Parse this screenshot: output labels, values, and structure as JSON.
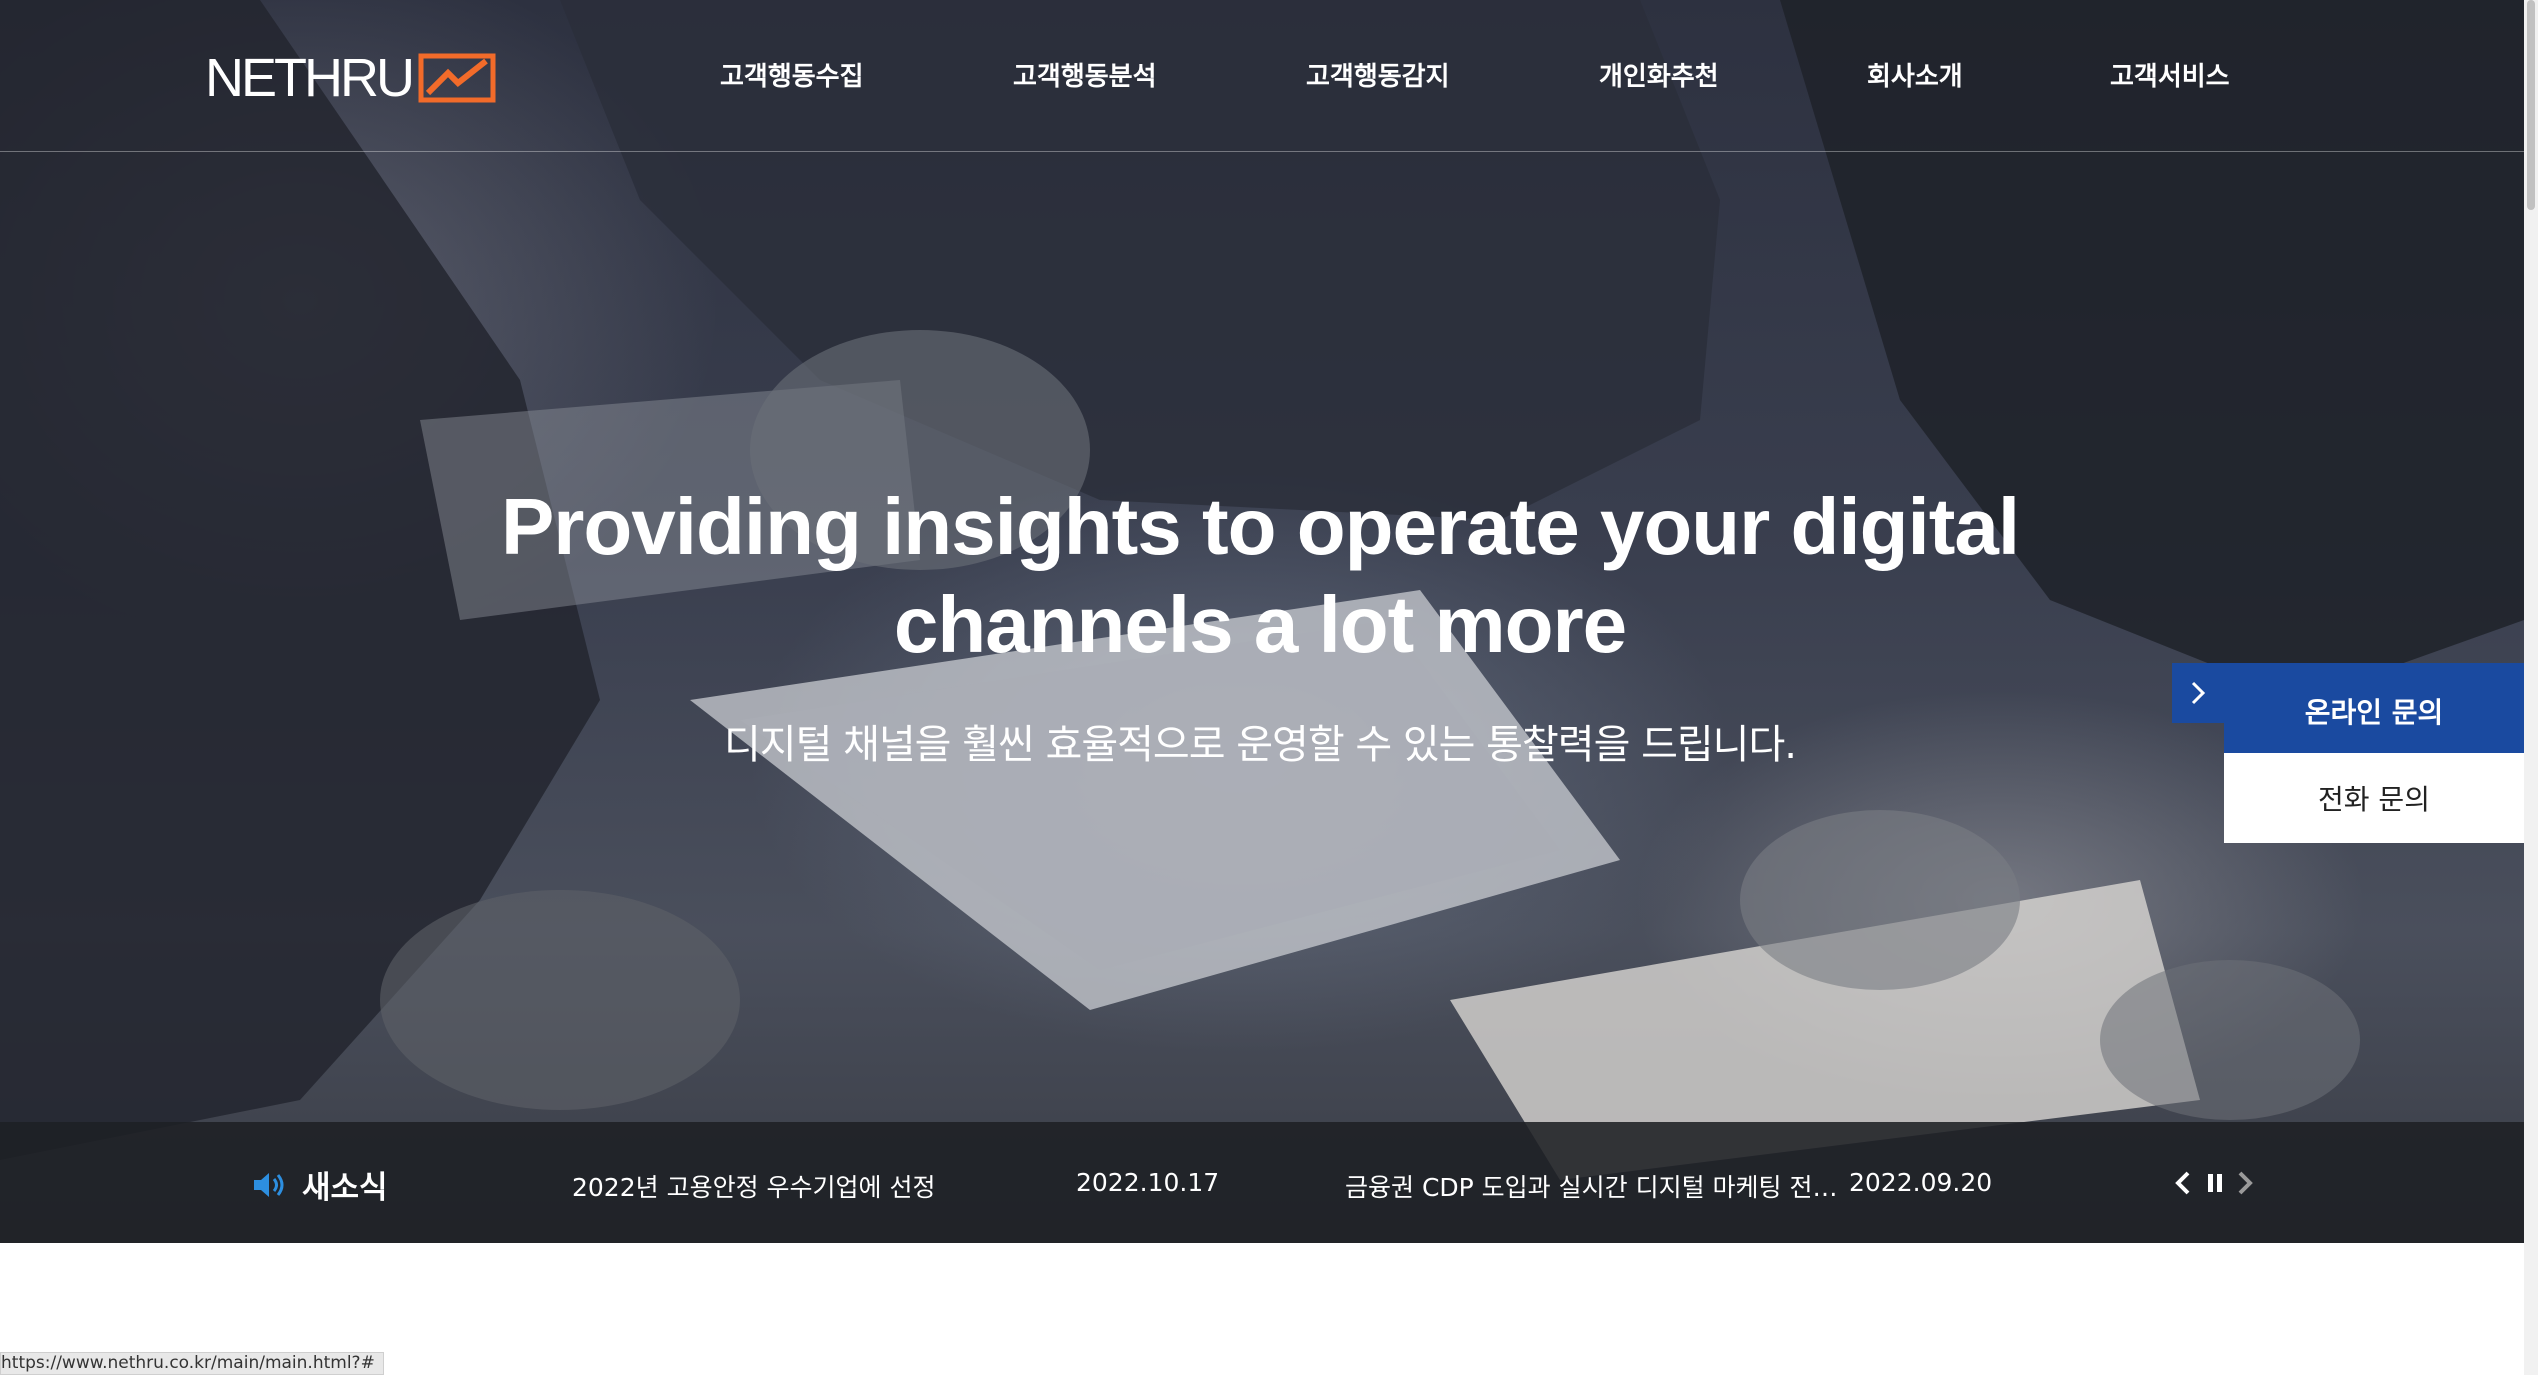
{
  "header": {
    "logo_text": "NETHRU",
    "nav": [
      {
        "label": "고객행동수집"
      },
      {
        "label": "고객행동분석"
      },
      {
        "label": "고객행동감지"
      },
      {
        "label": "개인화추천"
      },
      {
        "label": "회사소개"
      },
      {
        "label": "고객서비스"
      }
    ]
  },
  "hero": {
    "headline_line1": "Providing insights to operate your digital",
    "headline_line2": "channels a lot more",
    "subline": "디지털 채널을 훨씬 효율적으로 운영할 수 있는 통찰력을 드립니다."
  },
  "side_panel": {
    "online_label": "온라인 문의",
    "phone_label": "전화 문의"
  },
  "news": {
    "title": "새소식",
    "items": [
      {
        "text": "2022년 고용안정 우수기업에 선정",
        "date": "2022.10.17"
      },
      {
        "text": "금융권 CDP 도입과 실시간 디지털 마케팅 전…",
        "date": "2022.09.20"
      }
    ]
  },
  "status_bar": {
    "url": "https://www.nethru.co.kr/main/main.html?#"
  },
  "colors": {
    "accent_orange": "#f26b2a",
    "panel_blue": "#1a4aa0",
    "news_icon_blue": "#2d8fe0"
  }
}
